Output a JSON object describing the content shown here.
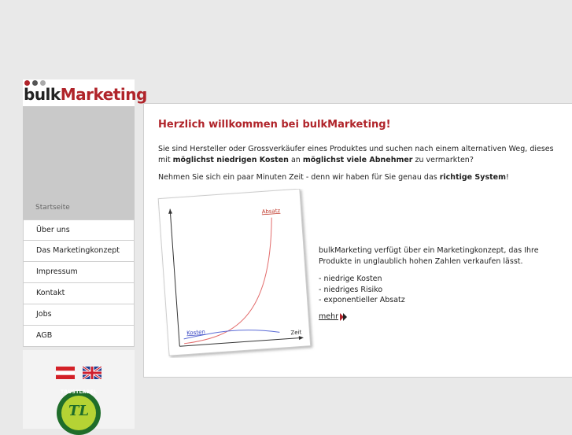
{
  "logo": {
    "bulk": "bulk",
    "marketing": "Marketing",
    "dots": [
      "#b0242a",
      "#555555",
      "#aaaaaa"
    ]
  },
  "sidebar": {
    "current": "Startseite",
    "items": [
      {
        "label": "Über uns"
      },
      {
        "label": "Das Marketingkonzept"
      },
      {
        "label": "Impressum"
      },
      {
        "label": "Kontakt"
      },
      {
        "label": "Jobs"
      },
      {
        "label": "AGB"
      }
    ]
  },
  "flags": {
    "at": "austria-flag",
    "uk": "uk-flag"
  },
  "trustlabel": {
    "top": "TRUSTLABEL",
    "mark": "TL"
  },
  "main": {
    "title": "Herzlich willkommen bei bulkMarketing!",
    "para1": {
      "pre": "Sie sind Hersteller oder Grossverkäufer eines Produktes und suchen nach einem alternativen Weg, dieses mit ",
      "b1": "möglichst niedrigen Kosten",
      "mid": " an ",
      "b2": "möglichst viele Abnehmer",
      "post": " zu vermarkten?"
    },
    "para2": {
      "pre": "Nehmen Sie sich ein paar Minuten Zeit - denn wir haben für Sie genau das ",
      "b": "richtige System",
      "post": "!"
    },
    "chart": {
      "absatz": "Absatz",
      "kosten": "Kosten",
      "zeit": "Zeit"
    },
    "desc": "bulkMarketing verfügt über ein Marketingkonzept, das Ihre Produkte in unglaublich hohen Zahlen verkaufen lässt.",
    "bullets": [
      "- niedrige Kosten",
      "- niedriges Risiko",
      "- exponentieller Absatz"
    ],
    "more": "mehr"
  },
  "colors": {
    "accent": "#b0242a",
    "sidebar_gray": "#c9c9c9",
    "background": "#e9e9e9"
  }
}
